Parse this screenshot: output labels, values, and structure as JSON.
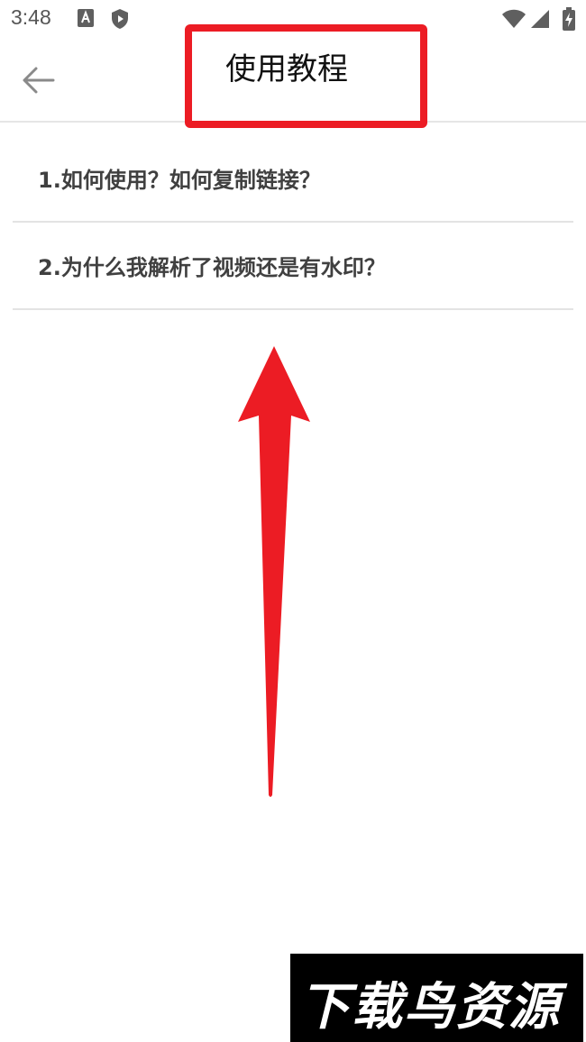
{
  "status_bar": {
    "time": "3:48",
    "icons_left": [
      "font-a-icon",
      "shield-play-icon"
    ],
    "icons_right": [
      "wifi-icon",
      "cell-signal-icon",
      "battery-charging-icon"
    ]
  },
  "app_bar": {
    "back_icon": "arrow-left-icon",
    "title": "使用教程"
  },
  "tutorial_list": {
    "items": [
      {
        "label": "1.如何使用？如何复制链接？"
      },
      {
        "label": "2.为什么我解析了视频还是有水印？"
      }
    ]
  },
  "annotation": {
    "highlight_color": "#ec1c24",
    "arrow_direction": "up"
  },
  "watermark": {
    "text": "下载鸟资源"
  }
}
